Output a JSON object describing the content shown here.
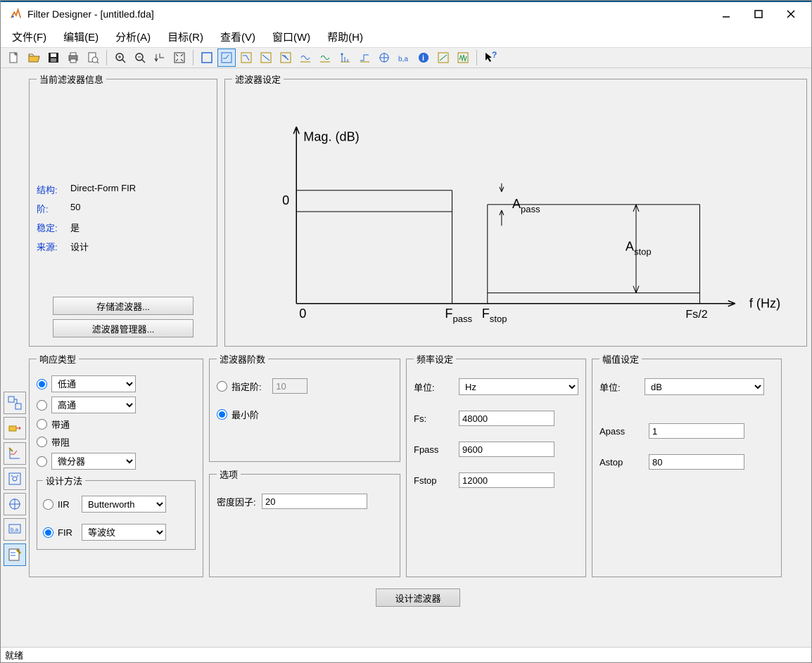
{
  "window": {
    "title": "Filter Designer - [untitled.fda]"
  },
  "menu": {
    "file": "文件(F)",
    "edit": "编辑(E)",
    "analysis": "分析(A)",
    "targets": "目标(R)",
    "view": "查看(V)",
    "window": "窗口(W)",
    "help": "帮助(H)"
  },
  "info": {
    "legend": "当前滤波器信息",
    "structure_label": "结构:",
    "structure_value": "Direct-Form FIR",
    "order_label": "阶:",
    "order_value": "50",
    "stable_label": "稳定:",
    "stable_value": "是",
    "source_label": "来源:",
    "source_value": "设计",
    "store_btn": "存储滤波器...",
    "manager_btn": "滤波器管理器..."
  },
  "spec": {
    "legend": "滤波器设定",
    "ylabel": "Mag. (dB)",
    "zero": "0",
    "fpass": "F",
    "fpass_sub": "pass",
    "fstop": "F",
    "fstop_sub": "stop",
    "apass": "A",
    "apass_sub": "pass",
    "astop": "A",
    "astop_sub": "stop",
    "fs2": "Fs/2",
    "xlabel": "f (Hz)"
  },
  "response": {
    "legend": "响应类型",
    "lowpass": "低通",
    "highpass": "高通",
    "bandpass": "带通",
    "bandstop": "带阻",
    "diff": "微分器",
    "design_legend": "设计方法",
    "iir_label": "IIR",
    "iir_method": "Butterworth",
    "fir_label": "FIR",
    "fir_method": "等波纹"
  },
  "order": {
    "legend": "滤波器阶数",
    "specify": "指定阶:",
    "specify_value": "10",
    "minimum": "最小阶"
  },
  "options": {
    "legend": "选项",
    "density_label": "密度因子:",
    "density_value": "20"
  },
  "freq": {
    "legend": "频率设定",
    "units_label": "单位:",
    "units_value": "Hz",
    "fs_label": "Fs:",
    "fs_value": "48000",
    "fpass_label": "Fpass",
    "fpass_value": "9600",
    "fstop_label": "Fstop",
    "fstop_value": "12000"
  },
  "mag": {
    "legend": "幅值设定",
    "units_label": "单位:",
    "units_value": "dB",
    "apass_label": "Apass",
    "apass_value": "1",
    "astop_label": "Astop",
    "astop_value": "80"
  },
  "design_btn": "设计滤波器",
  "status": "就绪"
}
